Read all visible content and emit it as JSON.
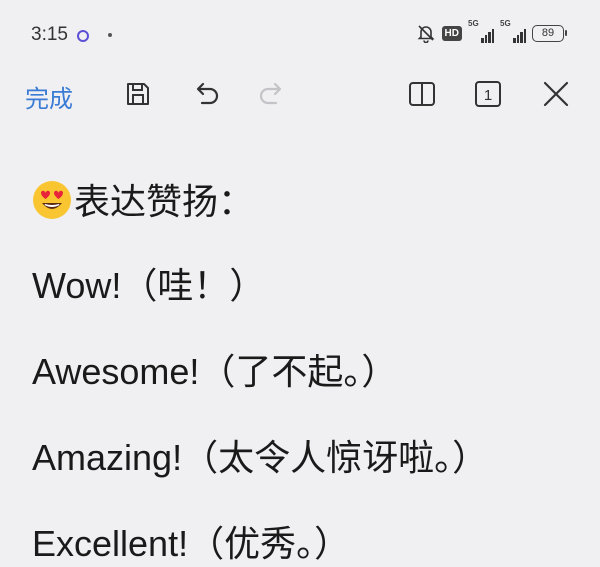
{
  "status_bar": {
    "time": "3:15",
    "hd_label": "HD",
    "signal_label_1": "5G",
    "signal_label_2": "5G",
    "battery": "89"
  },
  "toolbar": {
    "done_label": "完成",
    "page_count": "1"
  },
  "document": {
    "lines": [
      {
        "emoji": "smiling-face-with-heart-eyes",
        "text": "表达赞扬："
      },
      {
        "text": "Wow!（哇！）"
      },
      {
        "text": "Awesome!（了不起。）"
      },
      {
        "text": "Amazing!（太令人惊讶啦。）"
      },
      {
        "text": "Excellent!（优秀。）"
      }
    ]
  },
  "colors": {
    "accent": "#3a7bd5",
    "background": "#f0f0f2"
  }
}
